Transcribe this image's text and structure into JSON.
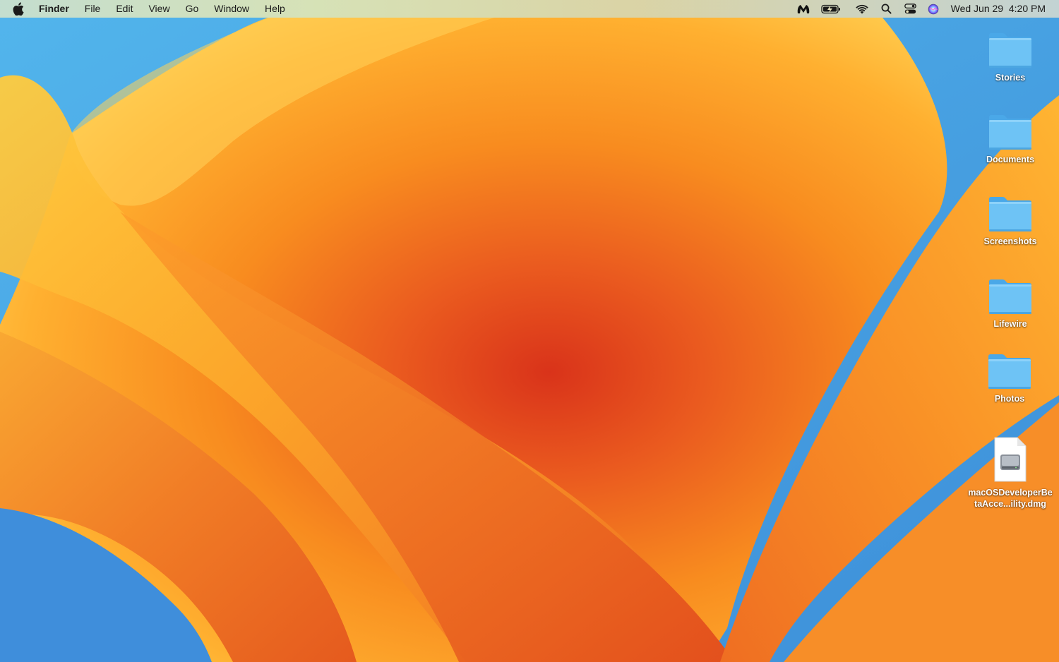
{
  "menubar": {
    "app_name": "Finder",
    "items": [
      "File",
      "Edit",
      "View",
      "Go",
      "Window",
      "Help"
    ],
    "clock": "Wed Jun 29  4:20 PM",
    "status_icons": [
      "malwarebytes-icon",
      "battery-icon",
      "wifi-icon",
      "search-icon",
      "control-center-icon",
      "siri-icon"
    ]
  },
  "desktop": {
    "items": [
      {
        "label": "Stories",
        "kind": "folder"
      },
      {
        "label": "Documents",
        "kind": "folder"
      },
      {
        "label": "Screenshots",
        "kind": "folder"
      },
      {
        "label": "Lifewire",
        "kind": "folder"
      },
      {
        "label": "Photos",
        "kind": "folder"
      },
      {
        "label": "macOSDeveloperBetaAcce...ility.dmg",
        "kind": "disk-image"
      }
    ]
  },
  "colors": {
    "folder_body": "#6ec3f5",
    "folder_tab": "#4aa8e8",
    "wallpaper_orange": "#f57c22",
    "wallpaper_yellow": "#ffcc44",
    "wallpaper_blue": "#3d8ed8"
  }
}
